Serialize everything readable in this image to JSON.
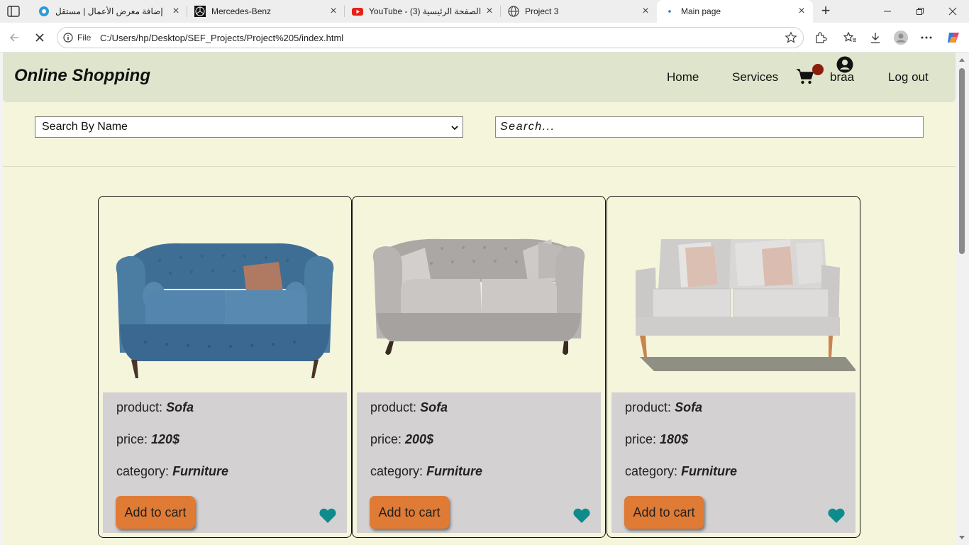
{
  "browser": {
    "tabs": [
      {
        "title": "إضافة معرض الأعمال | مستقل",
        "icon": "mostaql-favicon-icon"
      },
      {
        "title": "Mercedes-Benz",
        "icon": "mercedes-favicon-icon"
      },
      {
        "title": "YouTube - الصفحة الرئيسية (3)",
        "icon": "youtube-favicon-icon"
      },
      {
        "title": "Project 3",
        "icon": "globe-icon"
      },
      {
        "title": "Main page",
        "icon": "loading-dot-icon"
      }
    ],
    "address": {
      "scheme_label": "File",
      "url": "C:/Users/hp/Desktop/SEF_Projects/Project%205/index.html"
    }
  },
  "site": {
    "logo": "Online Shopping",
    "nav": {
      "home": "Home",
      "services": "Services",
      "username": "braa",
      "logout": "Log out"
    },
    "filter": {
      "selected": "Search By Name"
    },
    "search": {
      "placeholder": "Search..."
    }
  },
  "products": [
    {
      "label_product": "product:",
      "name": "Sofa",
      "label_price": "price:",
      "price": "120$",
      "label_category": "category:",
      "category": "Furniture",
      "button": "Add to cart",
      "color": "#3f6e94"
    },
    {
      "label_product": "product:",
      "name": "Sofa",
      "label_price": "price:",
      "price": "200$",
      "label_category": "category:",
      "category": "Furniture",
      "button": "Add to cart",
      "color": "#b3b0ae"
    },
    {
      "label_product": "product:",
      "name": "Sofa",
      "label_price": "price:",
      "price": "180$",
      "label_category": "category:",
      "category": "Furniture",
      "button": "Add to cart",
      "color": "#d2d0ce"
    }
  ],
  "colors": {
    "page_bg": "#f5f5dc",
    "header_bg": "#dfe5cc",
    "button": "#e07b36",
    "heart": "#0e8c8c",
    "cart_badge": "#8b1e0a"
  }
}
